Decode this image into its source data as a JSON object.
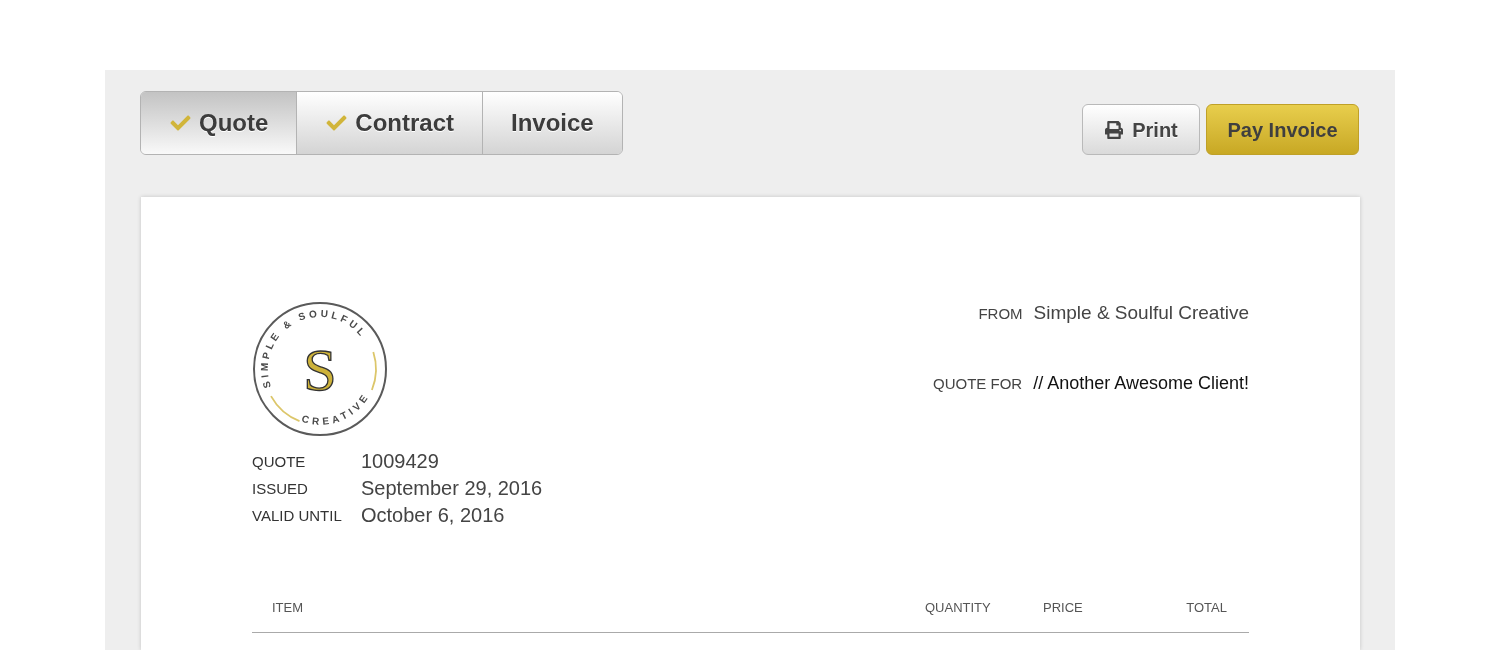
{
  "tabs": [
    {
      "label": "Quote",
      "selected": true,
      "done": true
    },
    {
      "label": "Contract",
      "selected": false,
      "done": true
    },
    {
      "label": "Invoice",
      "selected": false,
      "done": false
    }
  ],
  "actions": [
    {
      "kind": "print",
      "label": "Print"
    },
    {
      "kind": "pay",
      "label": "Pay Invoice"
    }
  ],
  "document": {
    "logo": {
      "arc_top": "SIMPLE & SOULFUL",
      "arc_bottom": "CREATIVE",
      "monogram": "S"
    },
    "meta": [
      {
        "label": "QUOTE",
        "value": "1009429"
      },
      {
        "label": "ISSUED",
        "value": "September 29, 2016"
      },
      {
        "label": "VALID UNTIL",
        "value": "October 6, 2016"
      }
    ],
    "parties": [
      {
        "kind": "sender",
        "label": "FROM",
        "value": "Simple & Soulful Creative"
      },
      {
        "kind": "recipient",
        "label": "QUOTE FOR",
        "value": "// Another Awesome Client!"
      }
    ],
    "table": {
      "columns": [
        "ITEM",
        "QUANTITY",
        "PRICE",
        "TOTAL"
      ]
    }
  }
}
